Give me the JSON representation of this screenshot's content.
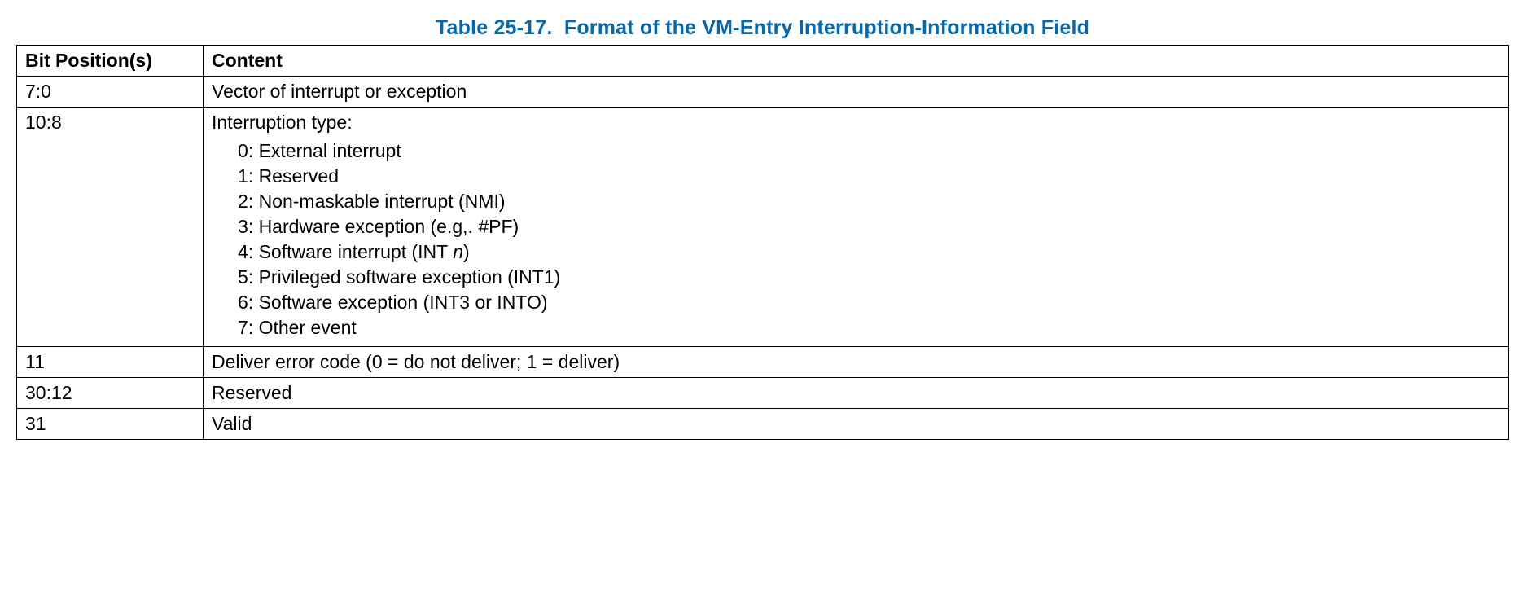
{
  "title_prefix": "Table 25-17.",
  "title_rest": "Format of the VM-Entry Interruption-Information Field",
  "headers": {
    "col1": "Bit Position(s)",
    "col2": "Content"
  },
  "rows": {
    "r0": {
      "bits": "7:0",
      "content": "Vector of interrupt or exception"
    },
    "r1": {
      "bits": "10:8",
      "lead": "Interruption type:",
      "items": {
        "i0": "0: External interrupt",
        "i1": "1: Reserved",
        "i2": "2: Non-maskable interrupt (NMI)",
        "i3": "3: Hardware exception (e.g,. #PF)",
        "i4a": "4: Software interrupt (INT ",
        "i4n": "n",
        "i4b": ")",
        "i5": "5: Privileged software exception (INT1)",
        "i6": "6: Software exception (INT3 or INTO)",
        "i7": "7: Other event"
      }
    },
    "r2": {
      "bits": "11",
      "content": "Deliver error code (0 = do not deliver; 1 = deliver)"
    },
    "r3": {
      "bits": "30:12",
      "content": "Reserved"
    },
    "r4": {
      "bits": "31",
      "content": "Valid"
    }
  }
}
